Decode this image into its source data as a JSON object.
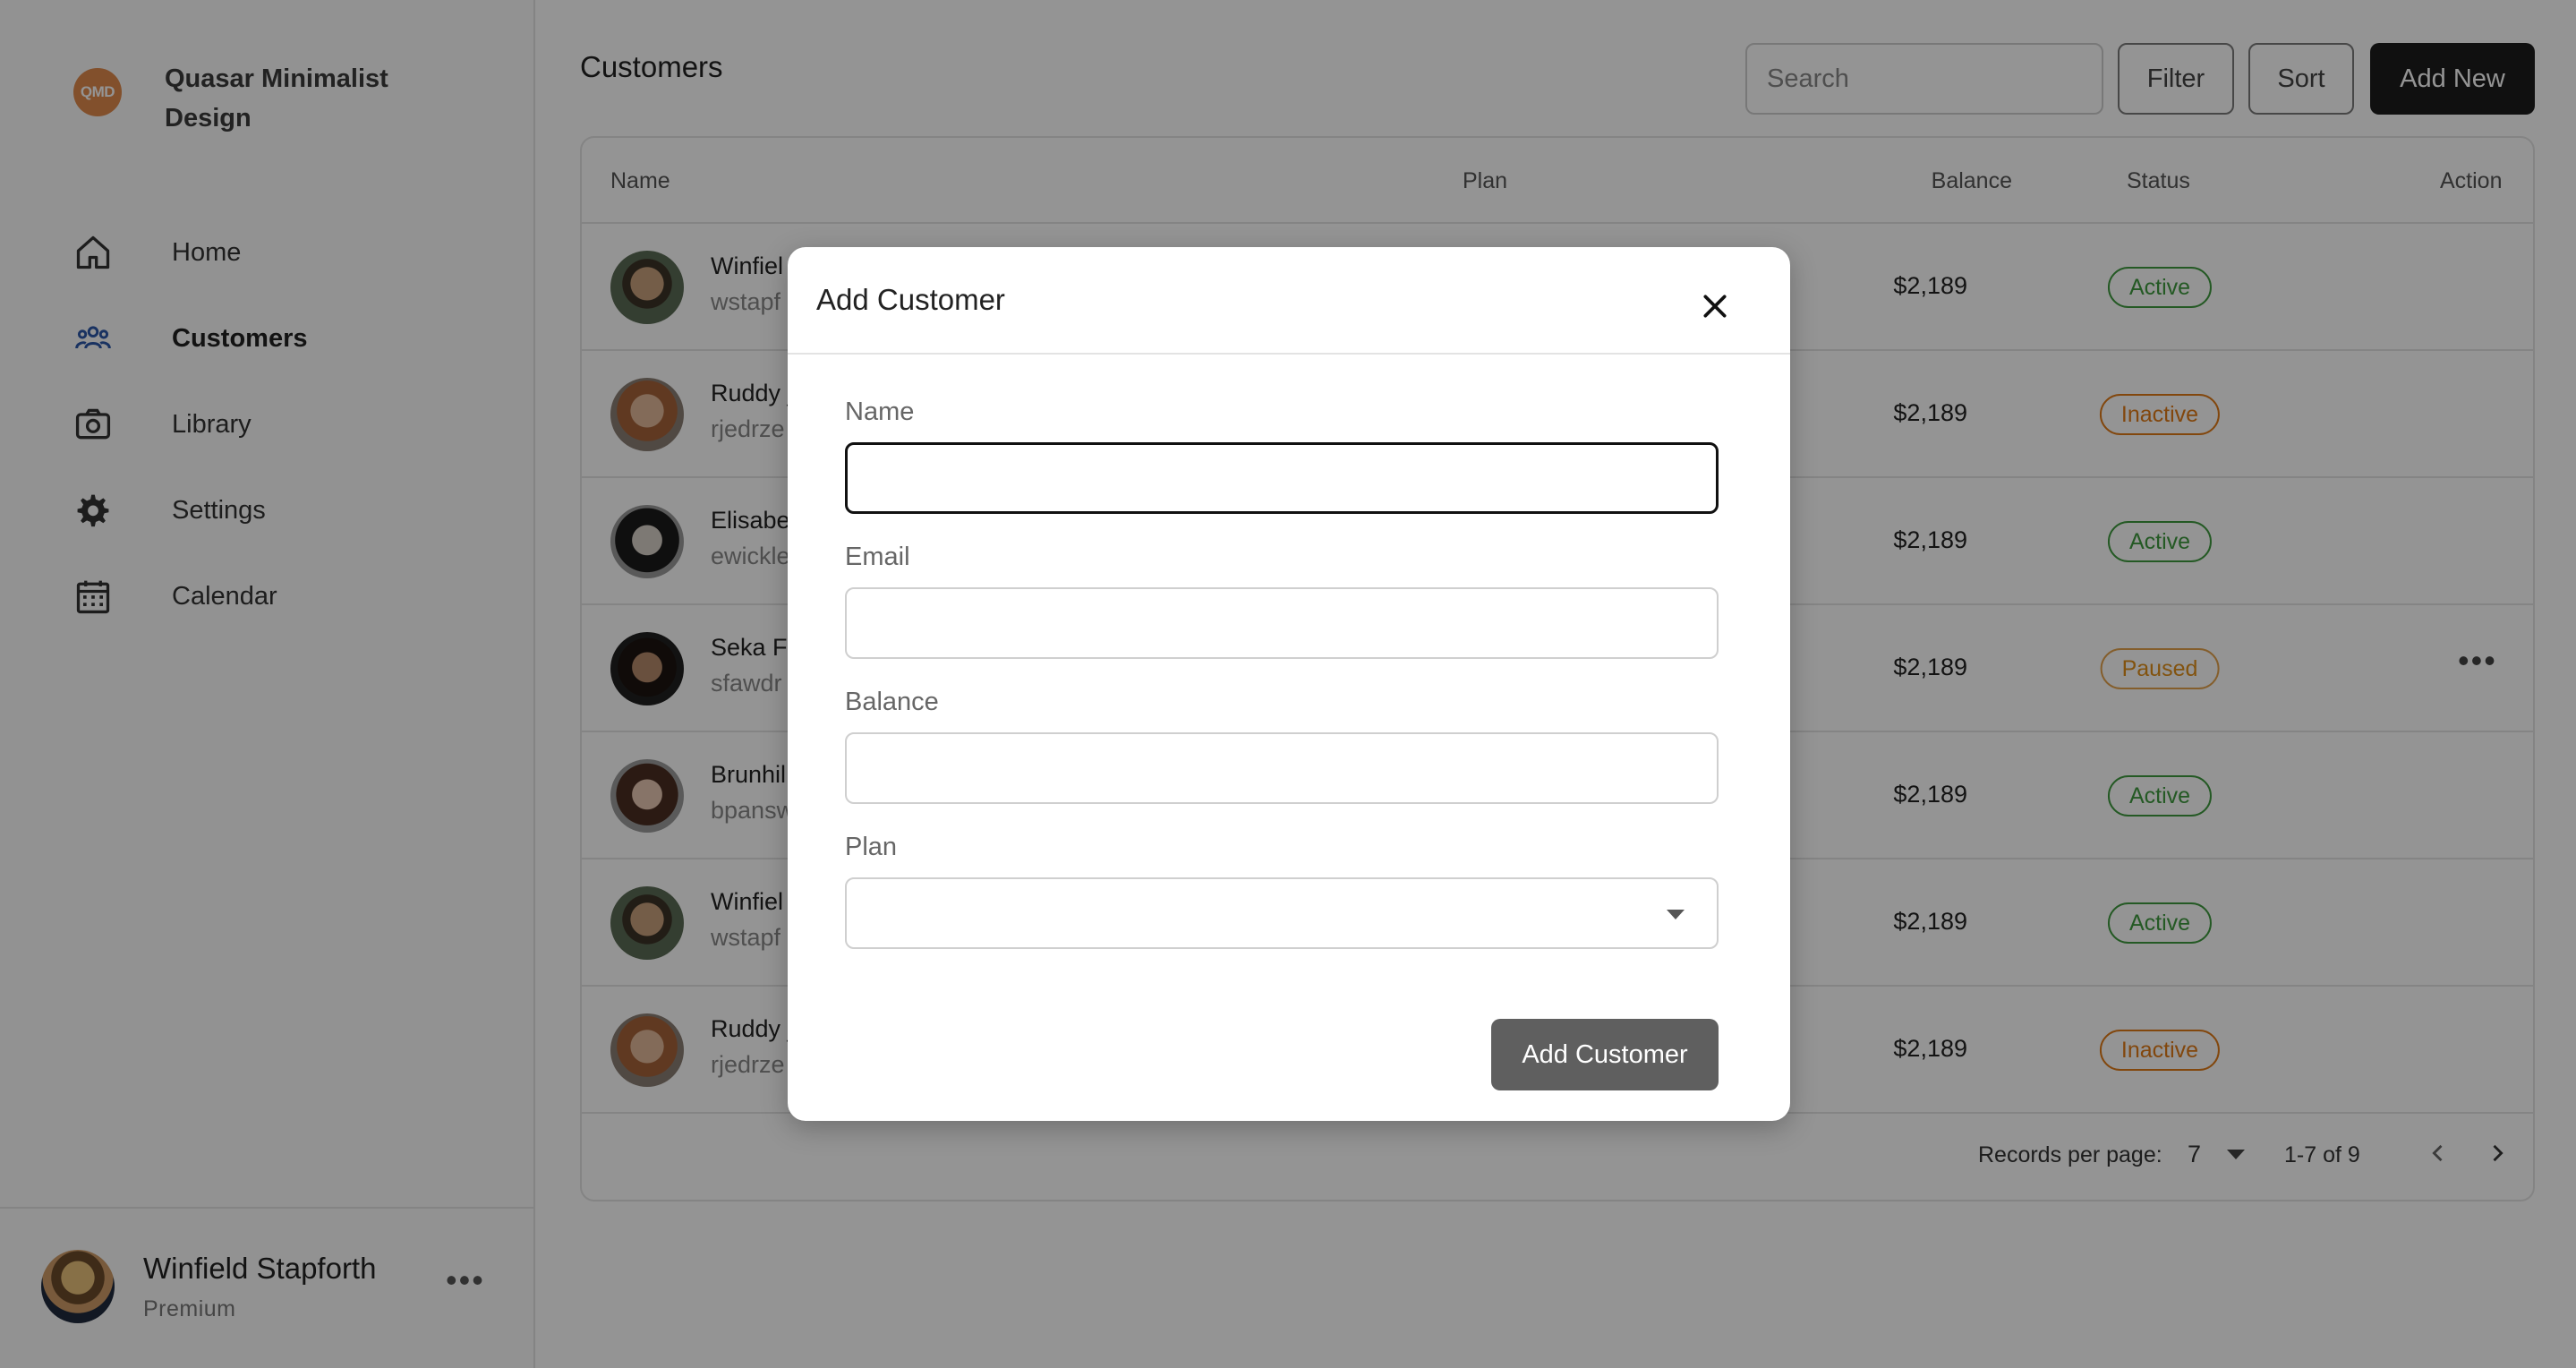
{
  "brand": {
    "logo_text": "QMD",
    "name": "Quasar Minimalist Design",
    "logo_color": "#E08A4C"
  },
  "sidebar": {
    "items": [
      {
        "label": "Home",
        "icon": "home-icon",
        "active": false
      },
      {
        "label": "Customers",
        "icon": "users-icon",
        "active": true
      },
      {
        "label": "Library",
        "icon": "camera-icon",
        "active": false
      },
      {
        "label": "Settings",
        "icon": "gear-icon",
        "active": false
      },
      {
        "label": "Calendar",
        "icon": "calendar-icon",
        "active": false
      }
    ],
    "user": {
      "name": "Winfield Stapforth",
      "plan": "Premium"
    }
  },
  "header": {
    "title": "Customers",
    "search_placeholder": "Search",
    "filter_label": "Filter",
    "sort_label": "Sort",
    "add_new_label": "Add New"
  },
  "table": {
    "columns": [
      "Name",
      "Plan",
      "Balance",
      "Status",
      "Action"
    ],
    "rows": [
      {
        "name": "Winfiel",
        "email": "wstapf",
        "balance": "$2,189",
        "status": "Active"
      },
      {
        "name": "Ruddy _",
        "email": "rjedrze",
        "balance": "$2,189",
        "status": "Inactive"
      },
      {
        "name": "Elisabe",
        "email": "ewickle",
        "balance": "$2,189",
        "status": "Active"
      },
      {
        "name": "Seka Fa",
        "email": "sfawdr",
        "balance": "$2,189",
        "status": "Paused"
      },
      {
        "name": "Brunhil",
        "email": "bpansw",
        "balance": "$2,189",
        "status": "Active"
      },
      {
        "name": "Winfiel",
        "email": "wstapf",
        "balance": "$2,189",
        "status": "Active"
      },
      {
        "name": "Ruddy _",
        "email": "rjedrze",
        "balance": "$2,189",
        "status": "Inactive"
      }
    ],
    "footer": {
      "records_label": "Records per page:",
      "records_value": "7",
      "range": "1-7 of 9"
    }
  },
  "modal": {
    "title": "Add Customer",
    "fields": {
      "name_label": "Name",
      "name_value": "",
      "email_label": "Email",
      "email_value": "",
      "balance_label": "Balance",
      "balance_value": "",
      "plan_label": "Plan",
      "plan_value": ""
    },
    "submit_label": "Add Customer"
  },
  "colors": {
    "active": "#3F9A3F",
    "inactive": "#E07A18",
    "paused": "#E08F1A",
    "nav_active": "#2B56A8"
  }
}
